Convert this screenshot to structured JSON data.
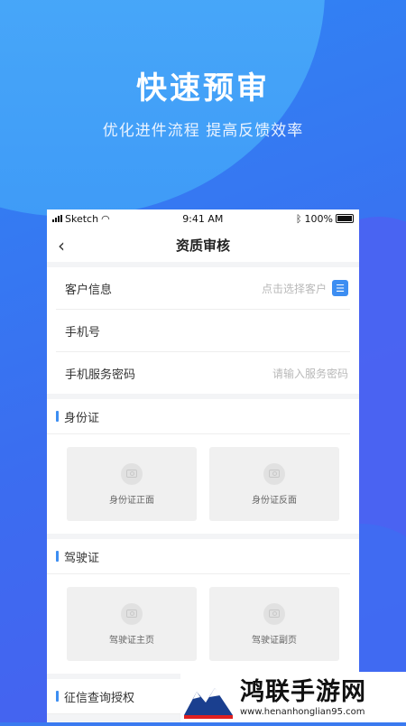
{
  "hero": {
    "title": "快速预审",
    "subtitle": "优化进件流程  提高反馈效率"
  },
  "status_bar": {
    "carrier": "Sketch",
    "time": "9:41 AM",
    "battery": "100%"
  },
  "nav": {
    "back_icon": "chevron-left-icon",
    "title": "资质审核"
  },
  "form": {
    "rows": [
      {
        "label": "客户信息",
        "placeholder": "点击选择客户",
        "icon": "contact-card-icon"
      },
      {
        "label": "手机号",
        "placeholder": ""
      },
      {
        "label": "手机服务密码",
        "placeholder": "请输入服务密码"
      }
    ]
  },
  "sections": [
    {
      "title": "身份证",
      "tiles": [
        {
          "label": "身份证正面"
        },
        {
          "label": "身份证反面"
        }
      ]
    },
    {
      "title": "驾驶证",
      "tiles": [
        {
          "label": "驾驶证主页"
        },
        {
          "label": "驾驶证副页"
        }
      ]
    },
    {
      "title": "征信查询授权"
    }
  ],
  "watermark": {
    "title": "鸿联手游网",
    "url": "www.henanhonglian95.com"
  },
  "colors": {
    "accent": "#3d8ef2",
    "background_gradient_start": "#2f86f4",
    "background_gradient_end": "#4a5ef0"
  }
}
